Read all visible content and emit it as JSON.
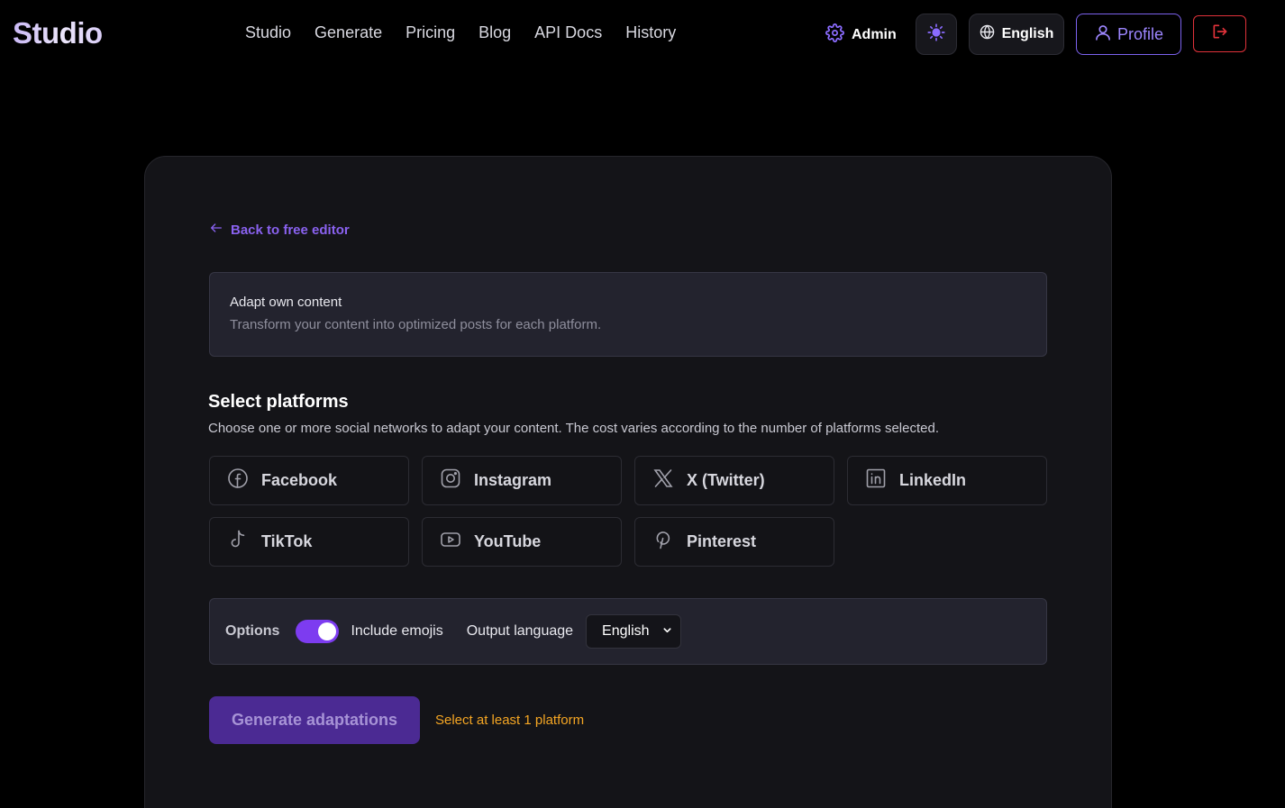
{
  "header": {
    "logo": "Studio",
    "nav": [
      "Studio",
      "Generate",
      "Pricing",
      "Blog",
      "API Docs",
      "History"
    ],
    "admin_label": "Admin",
    "language_label": "English",
    "profile_label": "Profile"
  },
  "card": {
    "back_link": "Back to free editor",
    "info": {
      "title": "Adapt own content",
      "subtitle": "Transform your content into optimized posts for each platform."
    },
    "platforms_title": "Select platforms",
    "platforms_desc": "Choose one or more social networks to adapt your content. The cost varies according to the number of platforms selected.",
    "platforms": [
      {
        "label": "Facebook",
        "icon": "facebook-icon"
      },
      {
        "label": "Instagram",
        "icon": "instagram-icon"
      },
      {
        "label": "X (Twitter)",
        "icon": "x-icon"
      },
      {
        "label": "LinkedIn",
        "icon": "linkedin-icon"
      },
      {
        "label": "TikTok",
        "icon": "tiktok-icon"
      },
      {
        "label": "YouTube",
        "icon": "youtube-icon"
      },
      {
        "label": "Pinterest",
        "icon": "pinterest-icon"
      }
    ],
    "options": {
      "label": "Options",
      "include_emojis_label": "Include emojis",
      "include_emojis_on": true,
      "output_language_label": "Output language",
      "output_language_value": "English"
    },
    "generate_label": "Generate adaptations",
    "warning": "Select at least 1 platform"
  },
  "colors": {
    "accent": "#7d3cf0",
    "link": "#8a62f0",
    "warning": "#f5a623",
    "logout": "#e0323a"
  }
}
